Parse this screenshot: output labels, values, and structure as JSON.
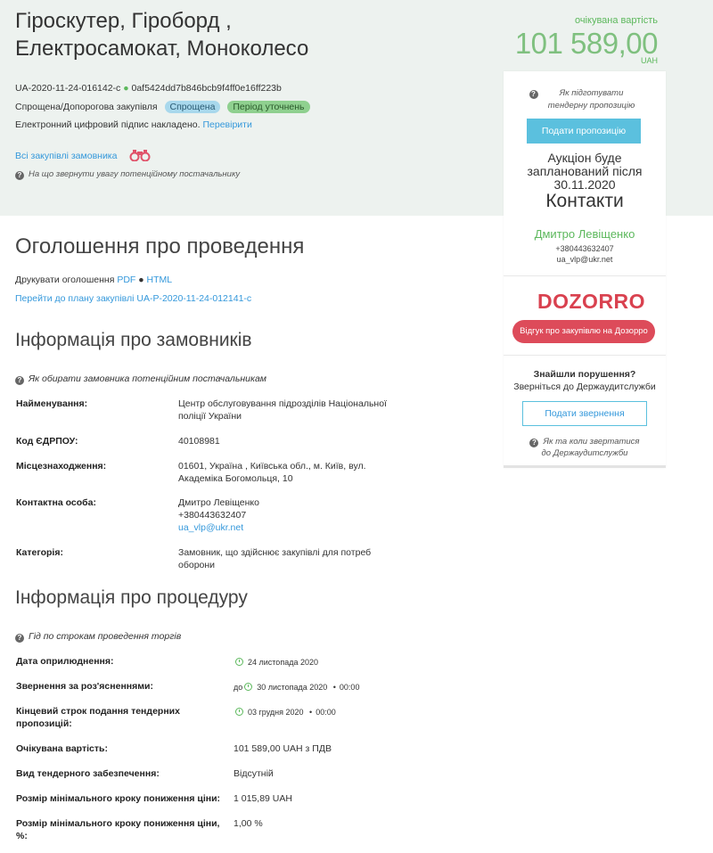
{
  "header": {
    "title": "Гіроскутер, Гіроборд , Електросамокат, Моноколесо",
    "tender_id": "UA-2020-11-24-016142-c",
    "tender_hash": "0af5424dd7b846bcb9f4ff0e16ff223b",
    "procedure_type": "Спрощена/Допорогова закупівля",
    "badge_type": "Спрощена",
    "badge_status": "Період уточнень",
    "signature_text": "Електронний цифровий підпис накладено.",
    "signature_link": "Перевірити",
    "all_purchases_link": "Всі закупівлі замовника",
    "supplier_help": "На що звернути увагу потенційному постачальнику"
  },
  "price": {
    "label": "очікувана вартість",
    "value": "101 589,00",
    "currency": "UAH"
  },
  "sidebar": {
    "prepare_help": "Як підготувати тендерну пропозицію",
    "submit_button": "Подати пропозицію",
    "auction_line1": "Аукціон буде",
    "auction_line2": "запланований після",
    "auction_date": "30.11.2020",
    "contacts_heading": "Контакти",
    "contact_name": "Дмитро Левіщенко",
    "contact_phone": "+380443632407",
    "contact_email": "ua_vlp@ukr.net",
    "dozorro_logo": "DOZORRO",
    "dozorro_button": "Відгук про закупівлю на Дозорро",
    "violations_heading": "Знайшли порушення?",
    "violations_text": "Зверніться до Держаудитслужби",
    "appeal_button": "Подати звернення",
    "appeal_help_line1": "Як та коли звертатися",
    "appeal_help_line2": "до Держаудитслужби"
  },
  "announcement": {
    "heading": "Оголошення про проведення",
    "print_label": "Друкувати оголошення",
    "print_pdf": "PDF",
    "print_html": "HTML",
    "plan_link": "Перейти до плану закупівлі UA-P-2020-11-24-012141-c"
  },
  "customers": {
    "heading": "Інформація про замовників",
    "help": "Як обирати замовника потенційним постачальникам",
    "rows": [
      {
        "label": "Найменування:",
        "value_line1": "Центр обслуговування підрозділів Національної",
        "value_line2": "поліції України"
      },
      {
        "label": "Код ЄДРПОУ:",
        "value_line1": "40108981"
      },
      {
        "label": "Місцезнаходження:",
        "value_line1": "01601, Україна , Київська обл., м. Київ, вул.",
        "value_line2": "Академіка Богомольця, 10"
      },
      {
        "label": "Контактна особа:",
        "value_line1": "Дмитро Левіщенко",
        "value_line2": "+380443632407",
        "value_link": "ua_vlp@ukr.net"
      },
      {
        "label": "Категорія:",
        "value_line1": "Замовник, що здійснює закупівлі для потреб",
        "value_line2": "оборони"
      }
    ]
  },
  "procedure": {
    "heading": "Інформація про процедуру",
    "help": "Гід по строкам проведення торгів",
    "rows": [
      {
        "label": "Дата оприлюднення:",
        "value": "24 листопада 2020"
      },
      {
        "label": "Звернення за роз'ясненнями:",
        "prefix": "до",
        "value": "30 листопада 2020",
        "time": "00:00"
      },
      {
        "label_line1": "Кінцевий строк подання тендерних",
        "label_line2": "пропозицій:",
        "value": "03 грудня 2020",
        "time": "00:00"
      },
      {
        "label": "Очікувана вартість:",
        "value": "101 589,00 UAH з ПДВ"
      },
      {
        "label": "Вид тендерного забезпечення:",
        "value": "Відсутній"
      },
      {
        "label": "Розмір мінімального кроку пониження ціни:",
        "value": "1 015,89 UAH"
      },
      {
        "label_line1": "Розмір мінімального кроку пониження ціни,",
        "label_line2": "%:",
        "value": "1,00 %"
      }
    ]
  },
  "colors": {
    "accent_green": "#5cb85c",
    "link_blue": "#3498db",
    "dozorro_red": "#dd4b5a",
    "header_bg": "#edf2ef"
  }
}
